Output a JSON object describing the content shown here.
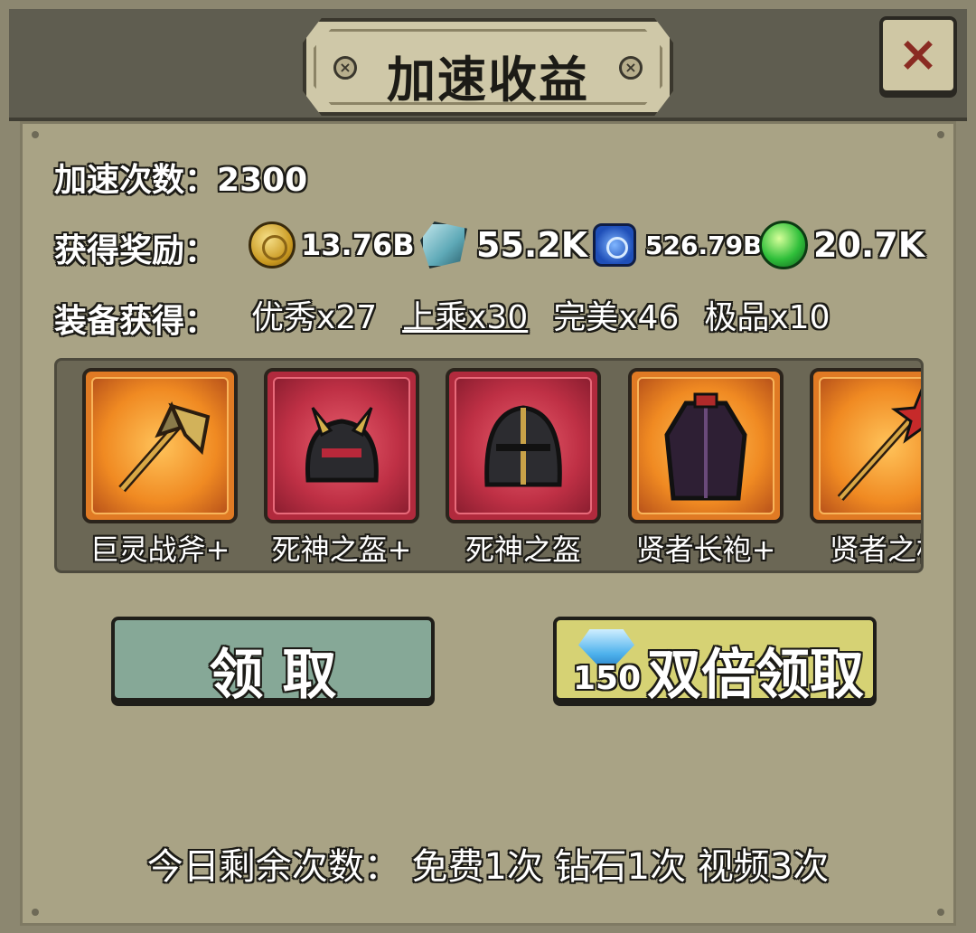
{
  "dialog": {
    "title": "加速收益",
    "close_icon": "×"
  },
  "stats": {
    "speedup_label": "加速次数：",
    "speedup_value": "2300",
    "rewards_label": "获得奖励：",
    "rewards": [
      {
        "icon": "gold-coin-icon",
        "value": "13.76B"
      },
      {
        "icon": "stone-icon",
        "value": "55.2K"
      },
      {
        "icon": "blue-orb-icon",
        "value": "526.79B"
      },
      {
        "icon": "green-essence-icon",
        "value": "20.7K"
      }
    ],
    "equip_label": "装备获得：",
    "equipment_grades": [
      "优秀x27",
      "上乘x30",
      "完美x46",
      "极品x10"
    ]
  },
  "items": [
    {
      "name": "巨灵战斧+",
      "icon": "battle-axe-icon",
      "rarity": "orange"
    },
    {
      "name": "死神之盔+",
      "icon": "death-helmet-icon",
      "rarity": "red"
    },
    {
      "name": "死神之盔",
      "icon": "knight-helmet-icon",
      "rarity": "red"
    },
    {
      "name": "贤者长袍+",
      "icon": "sage-robe-icon",
      "rarity": "orange"
    },
    {
      "name": "贤者之杖",
      "icon": "sage-staff-icon",
      "rarity": "orange"
    }
  ],
  "buttons": {
    "claim_label": "领 取",
    "double_claim_label": "双倍领取",
    "double_cost": "150",
    "cost_icon": "diamond-icon"
  },
  "footer": {
    "remaining_text": "今日剩余次数： 免费1次 钻石1次 视频3次"
  },
  "colors": {
    "panel": "#a9a385",
    "claim_button": "#86a897",
    "double_button": "#d6d274",
    "close_x": "#8a2b22"
  }
}
